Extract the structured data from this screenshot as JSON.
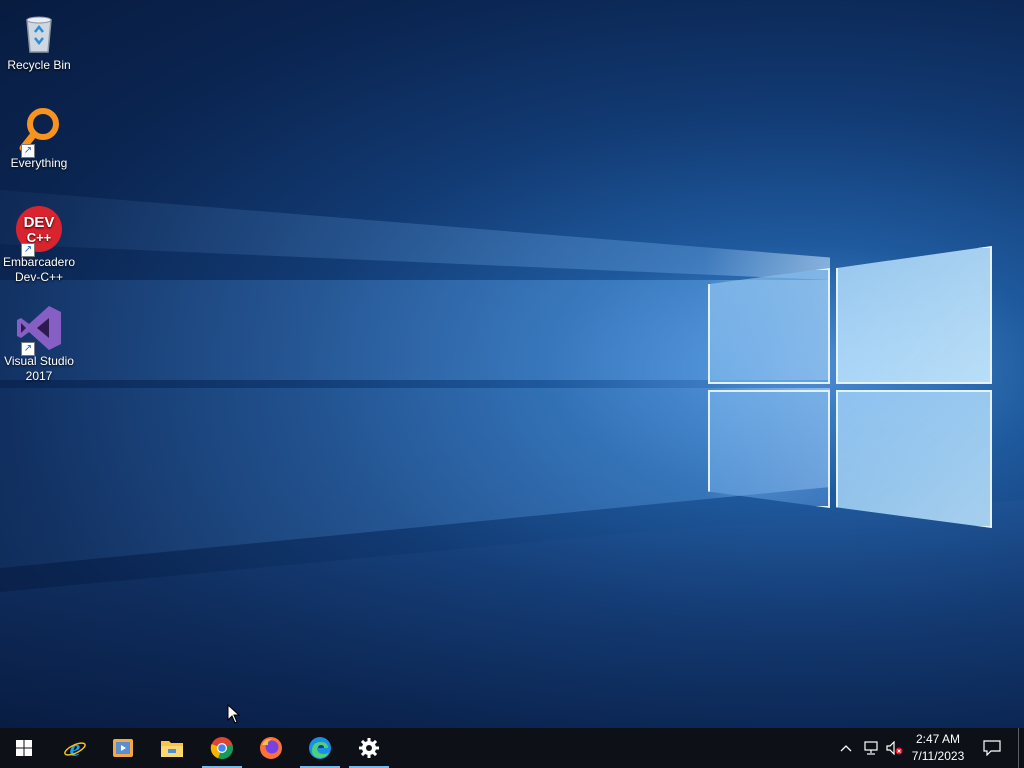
{
  "desktop": {
    "icons": [
      {
        "label": "Recycle Bin",
        "icon": "recycle-bin-icon"
      },
      {
        "label": "Everything",
        "icon": "everything-search-icon"
      },
      {
        "label": "Embarcadero Dev-C++",
        "icon": "devcpp-icon",
        "badge": "DEV C++"
      },
      {
        "label": "Visual Studio 2017",
        "icon": "visual-studio-icon"
      }
    ]
  },
  "taskbar": {
    "apps": [
      {
        "name": "Start",
        "icon": "windows-start-icon"
      },
      {
        "name": "Internet Explorer",
        "icon": "internet-explorer-icon"
      },
      {
        "name": "Media Player",
        "icon": "media-player-icon"
      },
      {
        "name": "File Explorer",
        "icon": "file-explorer-icon"
      },
      {
        "name": "Google Chrome",
        "icon": "chrome-icon"
      },
      {
        "name": "Firefox",
        "icon": "firefox-icon"
      },
      {
        "name": "Microsoft Edge",
        "icon": "edge-icon"
      },
      {
        "name": "Settings",
        "icon": "settings-gear-icon"
      }
    ],
    "clock": {
      "time": "2:47 AM",
      "date": "7/11/2023"
    }
  },
  "colors": {
    "taskbar": "#0d1117",
    "active_indicator": "#76b9ed"
  }
}
